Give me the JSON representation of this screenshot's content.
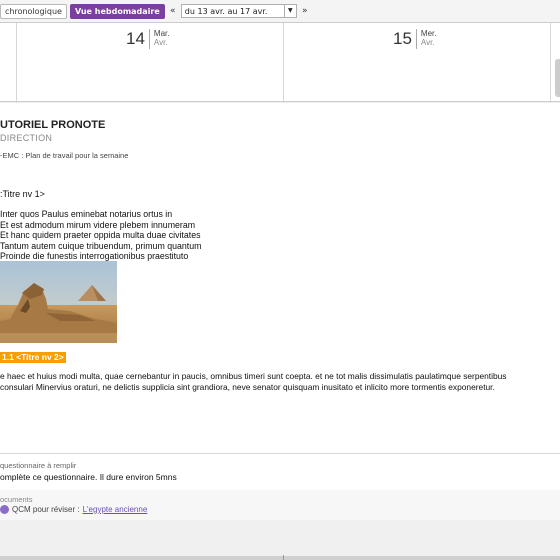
{
  "toolbar": {
    "tab_chrono": "chronologique",
    "tab_week": "Vue hebdomadaire",
    "prev_icon": "double-chevron-left",
    "next_icon": "double-chevron-right",
    "week_value": "du 13 avr. au 17 avr.",
    "accent": "#7b3fa0"
  },
  "days": [
    {
      "num": "14",
      "weekday": "Mar.",
      "month": "Avr."
    },
    {
      "num": "15",
      "weekday": "Mer.",
      "month": "Avr."
    }
  ],
  "course": {
    "title": "UTORIEL PRONOTE",
    "subtitle": "DIRECTION",
    "plan": "-EMC : Plan de travail pour la semaine"
  },
  "lesson": {
    "heading1": ":Titre nv 1>",
    "poem": [
      "Inter quos Paulus eminebat notarius ortus in",
      "Et est admodum mirum videre plebem innumeram",
      "Et hanc quidem praeter oppida multa duae civitates",
      "Tantum autem cuique tribuendum, primum quantum",
      "Proinde die funestis interrogationibus praestituto"
    ],
    "image": "sphinx-photo",
    "heading2": "1.1 <Titre nv 2>",
    "paragraph": [
      "e haec et huius modi multa, quae cernebantur in paucis, omnibus timeri sunt coepta. et ne tot malis dissimulatis paulatimque serpentibus",
      "consulari Minervius oraturi, ne delictis supplicia sint grandiora, neve senator quisquam inusitato et inlicito more tormentis exponeretur."
    ]
  },
  "quiz": {
    "label": "questionnaire à remplir",
    "text": "omplète ce questionnaire. Il dure environ 5mns"
  },
  "documents": {
    "label": "ocuments",
    "item_prefix": "QCM pour réviser :",
    "item_link": "L'egypte ancienne",
    "icon": "qcm-icon"
  }
}
